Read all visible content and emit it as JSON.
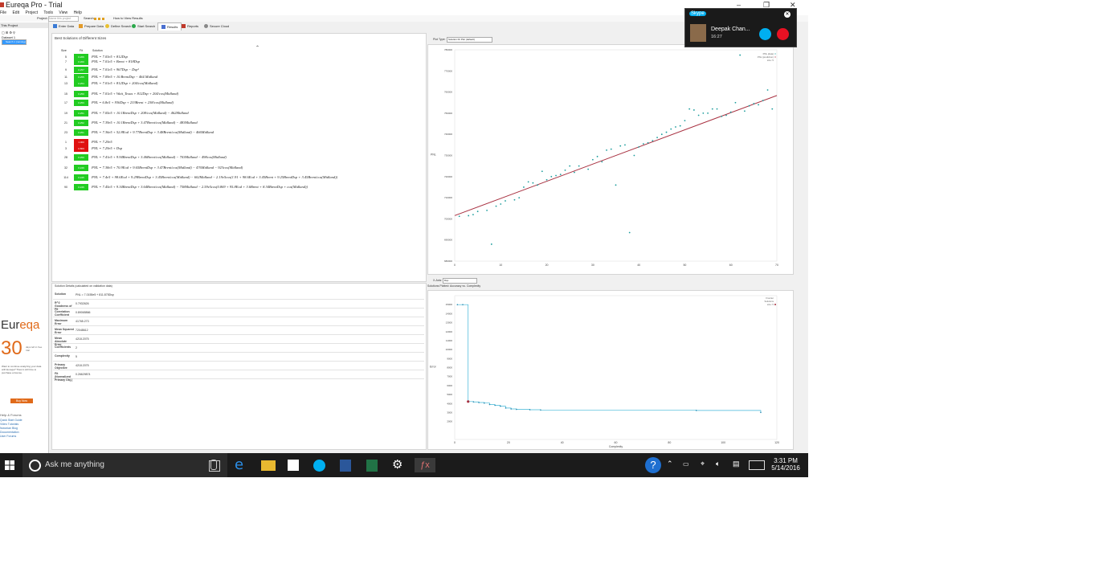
{
  "window": {
    "title": "Eureqa Pro - Trial"
  },
  "menu": [
    "File",
    "Edit",
    "Project",
    "Tools",
    "View",
    "Help"
  ],
  "toolbar": {
    "project_label": "Project:",
    "project_placeholder": "Name this project",
    "search_label": "Search:",
    "howto_label": "How to View Results"
  },
  "sidebar": {
    "header": "This Project",
    "tree": [
      "Dataset 1",
      "Search 1 (running)"
    ]
  },
  "tabs": [
    "Enter Data",
    "Prepare Data",
    "Define Search",
    "Start Search",
    "Results",
    "Reports",
    "Secure Cloud"
  ],
  "solutions": {
    "title": "Best Solutions of Different Sizes",
    "headers": [
      "Size",
      "Fit",
      "Solution"
    ],
    "rows": [
      {
        "size": "5",
        "fit": "0.266",
        "eq": "PNL = 7.03e5 + 812Dsp"
      },
      {
        "size": "7",
        "fit": "0.260",
        "eq": "PNL = 7.01e5 + Brent + 818Dsp"
      },
      {
        "size": "9",
        "fit": "0.257",
        "eq": "PNL = 7.01e5 + 967Dsp − Dsp²"
      },
      {
        "size": "11",
        "fit": "0.255",
        "eq": "PNL = 7.09e5 + 10.BrentDsp − 464.Midland"
      },
      {
        "size": "13",
        "fit": "0.254",
        "eq": "PNL = 7.01e5 + 812Dsp + 204/cos(Midland)"
      },
      {
        "size": "15",
        "fit": "0.250",
        "eq": "PNL = 7.01e5 + Wait_Texas + 812Dsp + 204/cos(Midland)"
      },
      {
        "size": "17",
        "fit": "0.253",
        "eq": "PNL = 6.8e5 + 936Dsp + 233Brent + 238/cos(Midland)"
      },
      {
        "size": "19",
        "fit": "0.251",
        "eq": "PNL = 7.05e5 + 10.1BrentDsp + 208/cos(Midland) − 462Midland"
      },
      {
        "size": "21",
        "fit": "0.252",
        "eq": "PNL = 7.39e5 + 10.1BrentDsp + 3.47Brent/cos(Midland) − 483Midland"
      },
      {
        "size": "23",
        "fit": "0.251",
        "eq": "PNL = 7.36e5 + 52.8Eod + 9.77BrentDsp + 3.48Brent/cos(Midland) − 466Midland"
      },
      {
        "size": "1",
        "fit": "1.000",
        "bad": true,
        "eq": "PNL = 7.29e5"
      },
      {
        "size": "3",
        "fit": "0.800",
        "bad": true,
        "eq": "PNL = 7.29e5 + Dsp"
      },
      {
        "size": "28",
        "fit": "0.250",
        "eq": "PNL = 7.41e5 + 9.94BrentDsp + 3.46Brent/cos(Midland) − 703Midland − 498cos(Midland)"
      },
      {
        "size": "32",
        "fit": "0.249",
        "eq": "PNL = 7.38e5 + 70.9Eod + 9.65BrentDsp + 3.47Brent/cos(Midland) − 476Midland − 923cos(Midland)"
      },
      {
        "size": "114",
        "fit": "0.245",
        "eq": "PNL = 7.4e5 + 98.6Eod + 9.29BrentDsp + 3.45Brent/cos(Midland) − 602Midland − 2.19e5cos(1.91 + 98.6Eod + 3.45Brent + 9.25BrentDsp + 3.45Brent/cos(Midland))"
      },
      {
        "size": "90",
        "fit": "0.246",
        "eq": "PNL = 7.45e5 + 9.34BrentDsp + 3.64Brent/cos(Midland) − 758Midland − 2.59e5cos(0.869 + 95.8Eod + 3.6Brent + 8.34BrentDsp + cos(Midland))"
      }
    ]
  },
  "details": {
    "title": "Solution Details (calculated on validation data)",
    "rows": [
      {
        "k": "Solution",
        "v": "PNL = 7.0155e5 + 811.875Dsp"
      },
      {
        "k": "R^2 Goodness of Fit",
        "v": "0.7932626"
      },
      {
        "k": "Correlation Coefficient",
        "v": "0.89065866"
      },
      {
        "k": "Maximum Error",
        "v": "41765.273"
      },
      {
        "k": "Mean Squared Error",
        "v": "72048612"
      },
      {
        "k": "Mean Absolute Error",
        "v": "4218.2075"
      },
      {
        "k": "Coefficients",
        "v": "2"
      },
      {
        "k": "Complexity",
        "v": "5"
      },
      {
        "k": "Primary Objective",
        "v": "4218.2075"
      },
      {
        "k": "Fit (Normalized Primary Obj.)",
        "v": "0.26629874"
      }
    ]
  },
  "plot_type": {
    "label": "Plot Type:",
    "value": "Solution Fit Plot (default)"
  },
  "xaxis_select": {
    "label": "X-Axis:",
    "value": "Dsp"
  },
  "pareto": {
    "title": "Solutions Plotted: Accuracy vs. Complexity",
    "xlabel": "Complexity",
    "ylabel": "Error"
  },
  "chart_data": [
    {
      "type": "scatter",
      "title": "",
      "xlabel": "",
      "ylabel": "PNL",
      "xlim": [
        0,
        70
      ],
      "ylim": [
        680000,
        780000
      ],
      "xticks": [
        0,
        10,
        20,
        30,
        40,
        50,
        60,
        70
      ],
      "yticks": [
        680000,
        690000,
        700000,
        710000,
        720000,
        730000,
        740000,
        750000,
        760000,
        770000,
        780000
      ],
      "legend": [
        "PNL (data)",
        "PNL (prediction)",
        "size: 5"
      ],
      "legend_position": "top-right",
      "series": [
        {
          "name": "PNL (data)",
          "points": [
            [
              1,
              701200
            ],
            [
              3,
              701500
            ],
            [
              4,
              702000
            ],
            [
              5,
              703500
            ],
            [
              7,
              704000
            ],
            [
              8,
              688000
            ],
            [
              9,
              706000
            ],
            [
              10,
              707000
            ],
            [
              11,
              708500
            ],
            [
              13,
              709000
            ],
            [
              14,
              710000
            ],
            [
              15,
              715000
            ],
            [
              16,
              717500
            ],
            [
              17,
              717000
            ],
            [
              18,
              716000
            ],
            [
              19,
              722500
            ],
            [
              20,
              718500
            ],
            [
              21,
              720000
            ],
            [
              22,
              720500
            ],
            [
              23,
              721000
            ],
            [
              24,
              723000
            ],
            [
              25,
              725000
            ],
            [
              26,
              722000
            ],
            [
              27,
              725000
            ],
            [
              29,
              723500
            ],
            [
              30,
              728000
            ],
            [
              31,
              729500
            ],
            [
              32,
              727000
            ],
            [
              33,
              732500
            ],
            [
              34,
              733000
            ],
            [
              35,
              716000
            ],
            [
              36,
              734500
            ],
            [
              37,
              735000
            ],
            [
              38,
              693500
            ],
            [
              39,
              730000
            ],
            [
              40,
              734000
            ],
            [
              41,
              735500
            ],
            [
              42,
              736000
            ],
            [
              43,
              737000
            ],
            [
              44,
              738500
            ],
            [
              45,
              740000
            ],
            [
              46,
              741000
            ],
            [
              47,
              742500
            ],
            [
              48,
              743500
            ],
            [
              49,
              744000
            ],
            [
              50,
              746500
            ],
            [
              51,
              752000
            ],
            [
              52,
              751500
            ],
            [
              53,
              749000
            ],
            [
              54,
              750000
            ],
            [
              55,
              750000
            ],
            [
              56,
              752000
            ],
            [
              57,
              752000
            ],
            [
              58,
              748500
            ],
            [
              59,
              749000
            ],
            [
              60,
              750500
            ],
            [
              61,
              755000
            ],
            [
              62,
              777500
            ],
            [
              63,
              751000
            ],
            [
              64,
              753500
            ],
            [
              65,
              754500
            ],
            [
              66,
              754000
            ],
            [
              67,
              756000
            ],
            [
              68,
              761000
            ],
            [
              69,
              752000
            ]
          ]
        },
        {
          "name": "PNL (prediction)",
          "line": [
            [
              0,
              701550
            ],
            [
              70,
              758380
            ]
          ]
        }
      ]
    },
    {
      "type": "line",
      "title": "Solutions Plotted: Accuracy vs. Complexity",
      "xlabel": "Complexity",
      "ylabel": "Error",
      "xlim": [
        0,
        120
      ],
      "ylim": [
        0,
        16000
      ],
      "xticks": [
        0,
        20,
        40,
        60,
        80,
        100,
        120
      ],
      "yticks": [
        2000,
        3000,
        4000,
        5000,
        6000,
        7000,
        8000,
        9000,
        10000,
        11000,
        12000,
        13000,
        14000,
        15000
      ],
      "legend": [
        "Frontier",
        "Solutions",
        "size: 5"
      ],
      "legend_position": "top-right",
      "series": [
        {
          "name": "Frontier",
          "points": [
            [
              1,
              15000
            ],
            [
              3,
              15000
            ],
            [
              5,
              4220
            ],
            [
              7,
              4180
            ],
            [
              9,
              4110
            ],
            [
              11,
              4050
            ],
            [
              13,
              3890
            ],
            [
              15,
              3800
            ],
            [
              17,
              3700
            ],
            [
              19,
              3500
            ],
            [
              21,
              3400
            ],
            [
              23,
              3350
            ],
            [
              28,
              3310
            ],
            [
              32,
              3280
            ],
            [
              90,
              3230
            ],
            [
              114,
              3010
            ]
          ]
        }
      ],
      "highlight": [
        5,
        4220
      ]
    }
  ],
  "trial": {
    "brand": "Eureqa",
    "days": "30",
    "days_text": "days left in free trial",
    "message": "Want to continue analyzing your data with Eureqa? There's still time to purchase a license.",
    "buy": "Buy Now"
  },
  "help": {
    "title": "Help & Forums",
    "links": [
      "Quick Start Guide",
      "Video Tutorials",
      "Nutonian Blog",
      "Documentation",
      "User Forums"
    ]
  },
  "taskbar": {
    "search_placeholder": "Ask me anything",
    "time": "3:31 PM",
    "date": "5/14/2016"
  },
  "skype": {
    "brand": "Skype",
    "caller": "Deepak Chan...",
    "duration": "16:27"
  },
  "colors": {
    "fit_good": "#22cc22",
    "fit_bad": "#e01010",
    "scatter": "#1a9c9c",
    "prediction": "#a83040",
    "pareto": "#3fb6d8",
    "accent": "#e06a1a"
  }
}
